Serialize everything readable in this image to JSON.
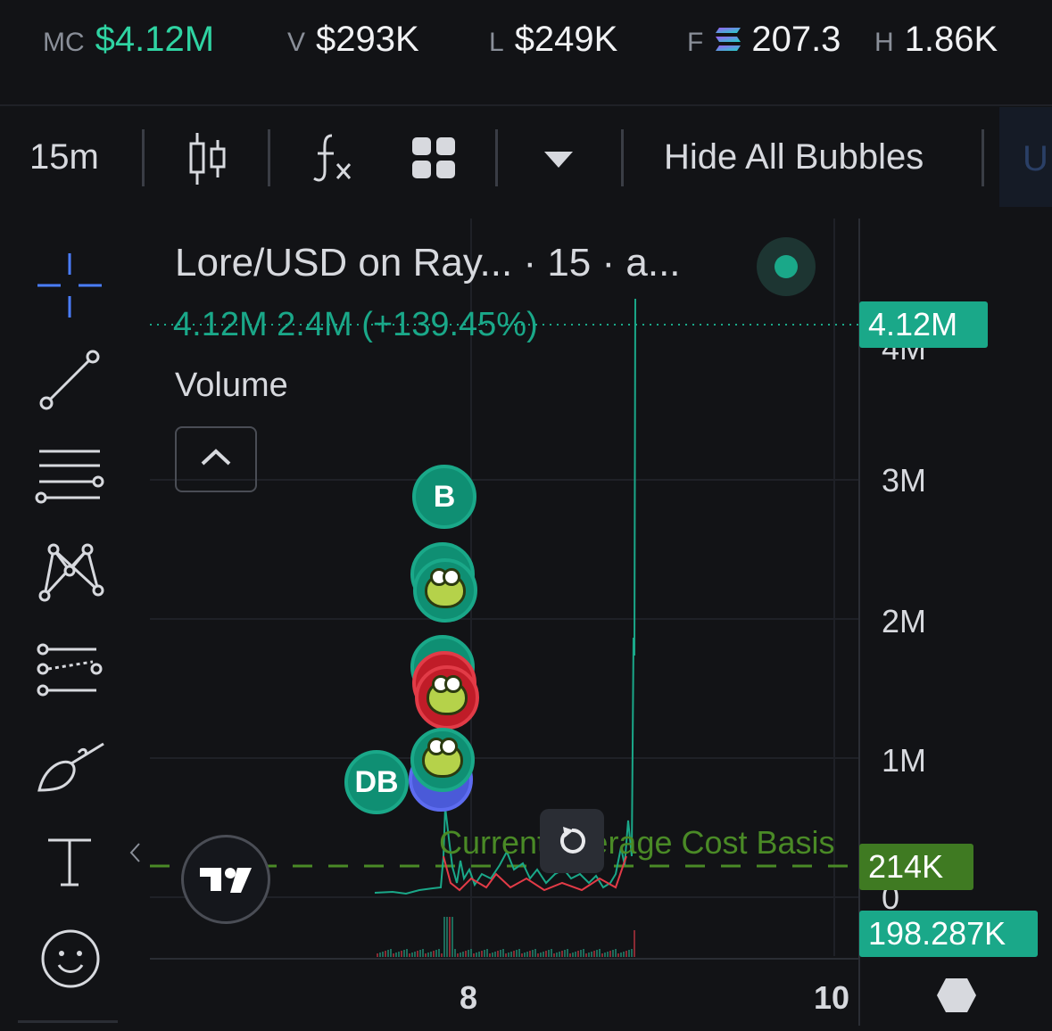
{
  "stats": {
    "mc_label": "MC",
    "mc_value": "$4.12M",
    "v_label": "V",
    "v_value": "$293K",
    "l_label": "L",
    "l_value": "$249K",
    "f_label": "F",
    "f_value": "207.3",
    "h_label": "H",
    "h_value": "1.86K"
  },
  "toolbar": {
    "interval": "15m",
    "hide_bubbles": "Hide All Bubbles",
    "partial_next": "U"
  },
  "legend": {
    "title": "Lore/USD on Ray... · 15 · a...",
    "values": "4.12M 2.4M (+139.45%)",
    "volume": "Volume"
  },
  "yaxis": {
    "labels": [
      "3M",
      "2M",
      "1M",
      "0"
    ],
    "partial_top": "4M"
  },
  "price_tags": {
    "last": "4.12M",
    "cost_basis": "214K",
    "other": "198.287K"
  },
  "cost_basis_label": "Current Average Cost Basis",
  "bubbles": {
    "b": "B",
    "db": "DB"
  },
  "xaxis": {
    "labels": [
      "8",
      "10"
    ]
  },
  "colors": {
    "green": "#1aa889",
    "mc_green": "#2fd3a2",
    "red": "#e23b47",
    "cost_basis": "#4a8a26"
  }
}
